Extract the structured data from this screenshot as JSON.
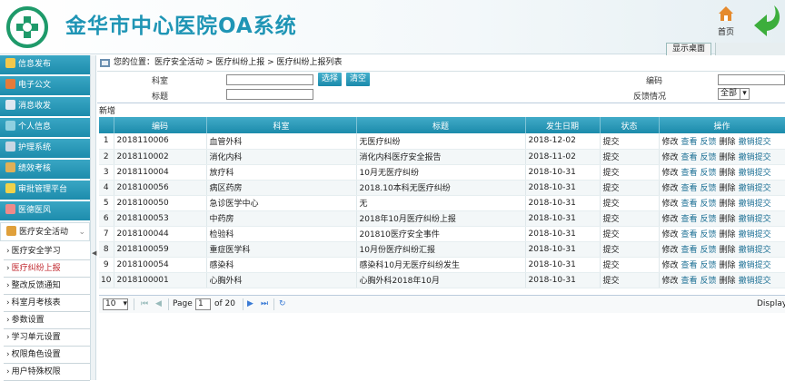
{
  "header": {
    "title": "金华市中心医院OA系统",
    "home_label": "首页",
    "desktop_tab": "显示桌面",
    "brand_color": "#1f95b5"
  },
  "sidebar": {
    "items": [
      {
        "label": "信息发布",
        "icon": "news-icon"
      },
      {
        "label": "电子公文",
        "icon": "document-icon"
      },
      {
        "label": "消息收发",
        "icon": "mail-icon"
      },
      {
        "label": "个人信息",
        "icon": "person-icon"
      },
      {
        "label": "护理系统",
        "icon": "nursing-icon"
      },
      {
        "label": "绩效考核",
        "icon": "chart-icon"
      },
      {
        "label": "审批管理平台",
        "icon": "approval-icon"
      },
      {
        "label": "医德医风",
        "icon": "ethics-icon"
      }
    ],
    "open_item": {
      "label": "医疗安全活动",
      "icon": "pencil-icon"
    },
    "subitems": [
      {
        "label": "医疗安全学习"
      },
      {
        "label": "医疗纠纷上报"
      },
      {
        "label": "整改反馈通知"
      },
      {
        "label": "科室月考核表"
      },
      {
        "label": "参数设置"
      },
      {
        "label": "学习单元设置"
      },
      {
        "label": "权限角色设置"
      },
      {
        "label": "用户特殊权限"
      }
    ],
    "active_subitem": "医疗纠纷上报"
  },
  "breadcrumb": "您的位置：医疗安全活动 > 医疗纠纷上报 > 医疗纠纷上报列表",
  "filters": {
    "dept_label": "科室",
    "title_label": "标题",
    "select_btn": "选择",
    "clear_btn": "清空",
    "code_label": "编码",
    "feedback_label": "反馈情况",
    "feedback_value": "全部"
  },
  "toolbar": {
    "add_label": "新增"
  },
  "table": {
    "columns": [
      "",
      "编码",
      "科室",
      "标题",
      "发生日期",
      "状态",
      "操作"
    ],
    "actions": [
      "修改",
      "查看",
      "反馈",
      "删除",
      "撤销提交"
    ],
    "rows": [
      {
        "n": "1",
        "code": "2018110006",
        "dept": "血管外科",
        "title": "无医疗纠纷",
        "date": "2018-12-02",
        "status": "提交"
      },
      {
        "n": "2",
        "code": "2018110002",
        "dept": "消化内科",
        "title": "消化内科医疗安全报告",
        "date": "2018-11-02",
        "status": "提交"
      },
      {
        "n": "3",
        "code": "2018110004",
        "dept": "放疗科",
        "title": "10月无医疗纠纷",
        "date": "2018-10-31",
        "status": "提交"
      },
      {
        "n": "4",
        "code": "2018100056",
        "dept": "病区药房",
        "title": "2018.10本科无医疗纠纷",
        "date": "2018-10-31",
        "status": "提交"
      },
      {
        "n": "5",
        "code": "2018100050",
        "dept": "急诊医学中心",
        "title": "无",
        "date": "2018-10-31",
        "status": "提交"
      },
      {
        "n": "6",
        "code": "2018100053",
        "dept": "中药房",
        "title": "2018年10月医疗纠纷上报",
        "date": "2018-10-31",
        "status": "提交"
      },
      {
        "n": "7",
        "code": "2018100044",
        "dept": "检验科",
        "title": "201810医疗安全事件",
        "date": "2018-10-31",
        "status": "提交"
      },
      {
        "n": "8",
        "code": "2018100059",
        "dept": "重症医学科",
        "title": "10月份医疗纠纷汇报",
        "date": "2018-10-31",
        "status": "提交"
      },
      {
        "n": "9",
        "code": "2018100054",
        "dept": "感染科",
        "title": "感染科10月无医疗纠纷发生",
        "date": "2018-10-31",
        "status": "提交"
      },
      {
        "n": "10",
        "code": "2018100001",
        "dept": "心胸外科",
        "title": "心胸外科2018年10月",
        "date": "2018-10-31",
        "status": "提交"
      }
    ]
  },
  "pager": {
    "page_size": "10",
    "page_label": "Page",
    "page_value": "1",
    "of_label": "of 20",
    "display_text": "Displayin"
  }
}
